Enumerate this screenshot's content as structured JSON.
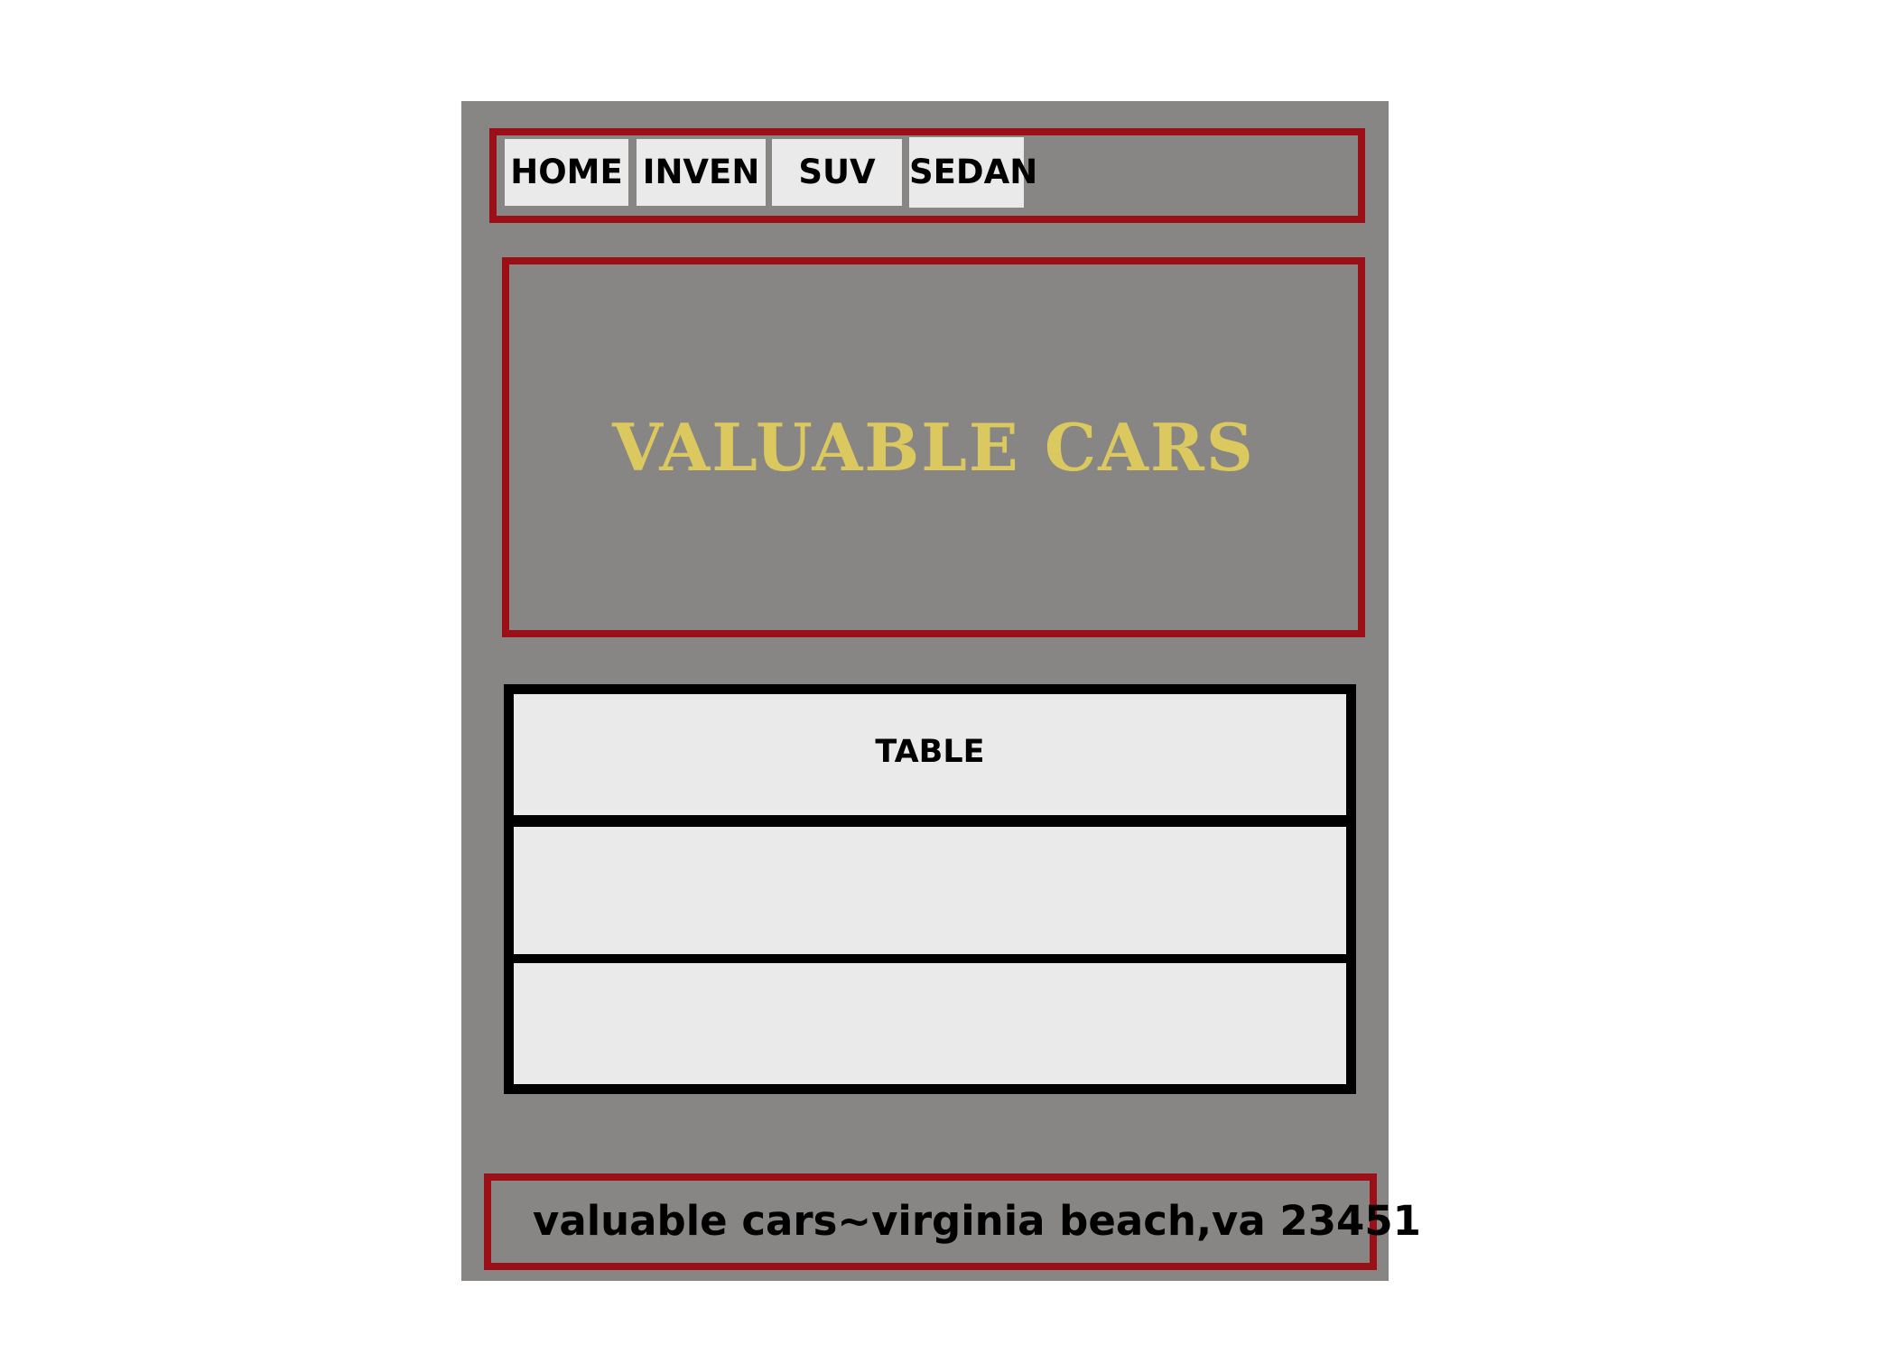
{
  "nav": {
    "items": [
      {
        "label": "HOME"
      },
      {
        "label": "INVEN"
      },
      {
        "label": "SUV"
      },
      {
        "label": "SEDAN"
      }
    ]
  },
  "banner": {
    "title": "VALUABLE CARS"
  },
  "table": {
    "header": "TABLE",
    "rows": [
      "",
      ""
    ]
  },
  "footer": {
    "text": "valuable cars~virginia beach,va 23451"
  },
  "colors": {
    "page_bg": "#878684",
    "accent_border": "#9a1016",
    "title_gold": "#dbc85e",
    "cell_bg": "#eaeaea"
  }
}
